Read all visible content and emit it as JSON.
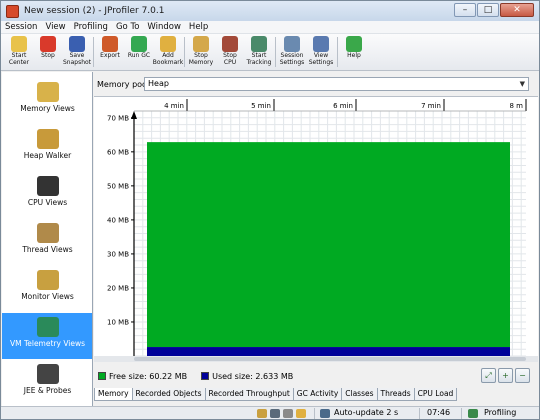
{
  "window": {
    "title": "New session (2) - JProfiler 7.0.1",
    "minimize": "–",
    "maximize": "□",
    "close": "✕"
  },
  "menu": [
    "Session",
    "View",
    "Profiling",
    "Go To",
    "Window",
    "Help"
  ],
  "toolbar": [
    {
      "label": "Start\nCenter",
      "icon": "start-center-icon",
      "color": "#e8c24a"
    },
    {
      "label": "Stop",
      "icon": "stop-icon",
      "color": "#d93a2b"
    },
    {
      "label": "Save\nSnapshot",
      "icon": "save-icon",
      "color": "#3a5fb0"
    },
    {
      "label": "Export",
      "icon": "export-icon",
      "color": "#cf5a2a"
    },
    {
      "label": "Run GC",
      "icon": "gc-icon",
      "color": "#34a852"
    },
    {
      "label": "Add\nBookmark",
      "icon": "bookmark-icon",
      "color": "#e0b040"
    },
    {
      "label": "Stop\nMemory",
      "icon": "memory-icon",
      "color": "#d4a84a"
    },
    {
      "label": "Stop\nCPU",
      "icon": "cpu-icon",
      "color": "#a34a3a"
    },
    {
      "label": "Start\nTracking",
      "icon": "tracking-icon",
      "color": "#4a8a6a"
    },
    {
      "label": "Session\nSettings",
      "icon": "session-settings-icon",
      "color": "#6a8ab0"
    },
    {
      "label": "View\nSettings",
      "icon": "view-settings-icon",
      "color": "#5a7ab0"
    },
    {
      "label": "Help",
      "icon": "help-icon",
      "color": "#3aa84a"
    }
  ],
  "sidebar": [
    {
      "label": "Memory Views",
      "icon": "memory-views-icon",
      "color": "#d8b24a",
      "selected": false
    },
    {
      "label": "Heap Walker",
      "icon": "heap-walker-icon",
      "color": "#c89a3a",
      "selected": false
    },
    {
      "label": "CPU Views",
      "icon": "cpu-views-icon",
      "color": "#333333",
      "selected": false
    },
    {
      "label": "Thread Views",
      "icon": "thread-views-icon",
      "color": "#b08a4a",
      "selected": false
    },
    {
      "label": "Monitor Views",
      "icon": "monitor-views-icon",
      "color": "#c8a040",
      "selected": false
    },
    {
      "label": "VM Telemetry Views",
      "icon": "vm-telemetry-icon",
      "color": "#2a8a5a",
      "selected": true
    },
    {
      "label": "JEE & Probes",
      "icon": "jee-probes-icon",
      "color": "#444444",
      "selected": false
    }
  ],
  "pool": {
    "label": "Memory pool:",
    "value": "Heap"
  },
  "chart_data": {
    "type": "area",
    "x_ticks": [
      "4 min",
      "5 min",
      "6 min",
      "7 min",
      "8 m"
    ],
    "y_ticks": [
      "10 MB",
      "20 MB",
      "30 MB",
      "40 MB",
      "50 MB",
      "60 MB",
      "70 MB"
    ],
    "ylim": [
      0,
      72
    ],
    "series": [
      {
        "name": "Free size: 60.22 MB",
        "value": 60.22,
        "color": "#00aa22"
      },
      {
        "name": "Used size: 2.633 MB",
        "value": 2.633,
        "color": "#000099"
      }
    ]
  },
  "tabs": [
    "Memory",
    "Recorded Objects",
    "Recorded Throughput",
    "GC Activity",
    "Classes",
    "Threads",
    "CPU Load"
  ],
  "status": {
    "auto_update": "Auto-update 2 s",
    "time": "07:46",
    "mode": "Profiling"
  }
}
